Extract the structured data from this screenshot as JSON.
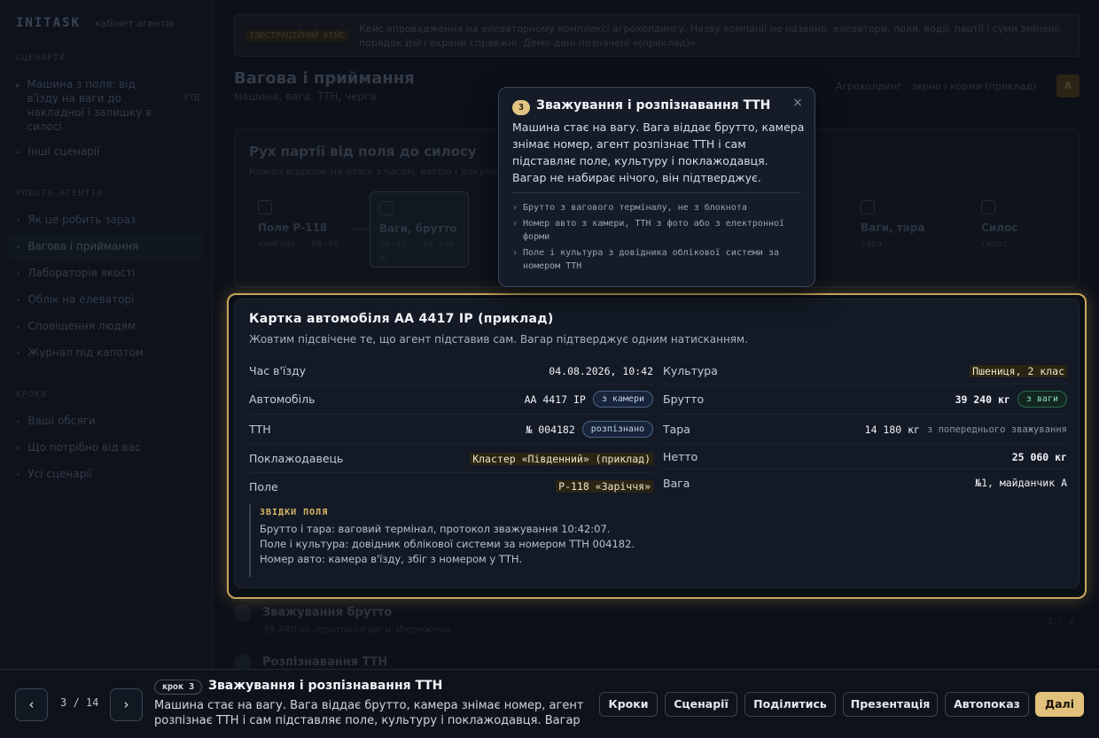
{
  "sidebar": {
    "brand": "INITASK",
    "brand_sub": "кабінет агентів",
    "section_scenario": "СЦЕНАРІЙ",
    "scenario_item": "Машина з поля: від в'їзду на ваги до накладної і залишку в силосі",
    "scenario_badge": "УТД",
    "other_scenarios": "Інші сценарії",
    "section_agents": "РОБОТА АГЕНТІВ",
    "agent_items": [
      "Як це робить зараз",
      "Вагова і приймання",
      "Лабораторія якості",
      "Облік на елеваторі",
      "Сповіщення людям",
      "Журнал під капотом"
    ],
    "section_next": "КРОКИ",
    "next_items": [
      "Ваші обсяги",
      "Що потрібно від вас",
      "Усі сценарії"
    ]
  },
  "callout": {
    "tag": "ІЛЮСТРАЦІЙНИЙ КЕЙС",
    "text": "Кейс впровадження на елеваторному комплексі агрохолдингу. Назву компанії не названо, елеватори, поля, водії, партії і суми змінені; порядок дій і екрани справжні. Демо-дані позначені «(приклад)»."
  },
  "page": {
    "title": "Вагова і приймання",
    "subtitle": "машина, вага, ТТН, черга",
    "breadcrumb": "Агрохолдинг · зерно і корми (приклад)",
    "avatar": "А"
  },
  "flow": {
    "title": "Рух партії від поля до силосу",
    "subtitle": "Кожен відрізок на етапі з часом, вагою і документом",
    "stages": [
      {
        "name": "Поле Р-118",
        "time": "комбайн · 08:40"
      },
      {
        "name": "Ваги, брутто",
        "time": "10:42 · 39 240 кг"
      },
      {
        "name": "Ваги, тара",
        "time": "тара"
      },
      {
        "name": "Силос",
        "time": "силос"
      }
    ]
  },
  "popover": {
    "step_num": "3",
    "title": "Зважування і розпізнавання ТТН",
    "body": "Машина стає на вагу. Вага віддає брутто, камера знімає номер, агент розпізнає ТТН і сам підставляє поле, культуру і поклажодавця. Вагар не набирає нічого, він підтверджує.",
    "points": [
      "Брутто з вагового терміналу, не з блокнота",
      "Номер авто з камери, ТТН з фото або з електронної форми",
      "Поле і культура з довідника облікової системи за номером ТТН"
    ],
    "close": "×"
  },
  "car_card": {
    "title": "Картка автомобіля АА 4417 ІР (приклад)",
    "subtitle": "Жовтим підсвічене те, що агент підставив сам. Вагар підтверджує одним натисканням.",
    "left": [
      {
        "label": "Час в'їзду",
        "value": "04.08.2026, 10:42"
      },
      {
        "label": "Автомобіль",
        "value": "АА 4417 ІР",
        "chip": "з камери"
      },
      {
        "label": "ТТН",
        "value": "№ 004182",
        "chip": "розпізнано"
      },
      {
        "label": "Поклажодавець",
        "value": "Кластер «Південний» (приклад)"
      },
      {
        "label": "Поле",
        "value": "Р-118 «Зарiччя»"
      }
    ],
    "right": [
      {
        "label": "Культура",
        "value": "Пшениця, 2 клас"
      },
      {
        "label": "Брутто",
        "value": "39 240 кг",
        "chip": "з ваги"
      },
      {
        "label": "Тара",
        "value": "14 180 кг",
        "note": "з попереднього зважування"
      },
      {
        "label": "Нетто",
        "value": "25 060 кг"
      },
      {
        "label": "Вага",
        "value": "№1, майданчик А"
      }
    ],
    "source_head": "ЗВІДКИ ПОЛЯ",
    "source_lines": [
      "Брутто і тара: ваговий термінал, протокол зважування 10:42:07.",
      "Поле і культура: довідник облікової системи за номером ТТН 004182.",
      "Номер авто: камера в'їзду, збіг з номером у ТТН."
    ]
  },
  "below": [
    {
      "title": "Зважування брутто",
      "sub": "39 240 кг, протокол ваги збережено",
      "right": "1 / 2"
    },
    {
      "title": "Розпізнавання ТТН",
      "sub": "",
      "right": ""
    }
  ],
  "bottombar": {
    "prev": "‹",
    "next": "›",
    "counter": "3 / 14",
    "step_chip": "крок 3",
    "step_title": "Зважування і розпізнавання ТТН",
    "step_desc": "Машина стає на вагу. Вага віддає брутто, камера знімає номер, агент розпізнає ТТН і сам підставляє поле, культуру і поклажодавця. Вагар не…",
    "buttons": [
      "Кроки",
      "Сценарії",
      "Поділитись",
      "Презентація",
      "Автопоказ"
    ],
    "primary": "Далі"
  },
  "colors": {
    "accent": "#e2c17c",
    "highlight_border": "#c9a65b",
    "chip_blue": "#4a6585",
    "chip_green": "#2f6a56"
  }
}
